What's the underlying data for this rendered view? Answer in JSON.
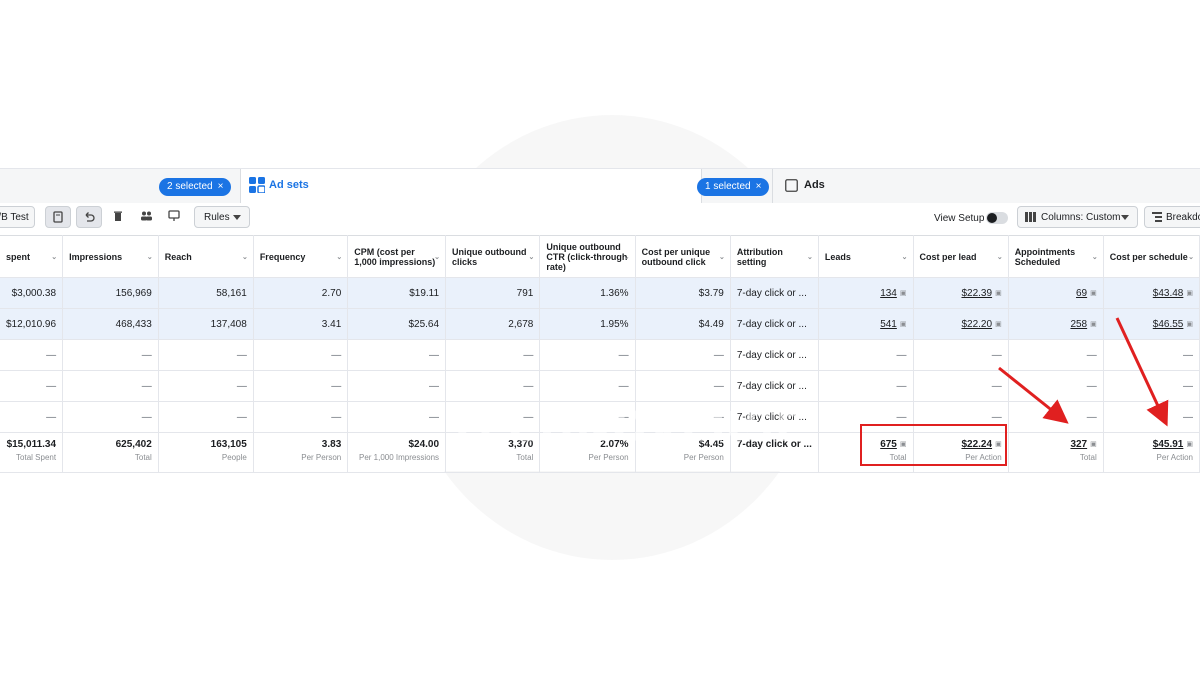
{
  "tabs": {
    "campaigns_selected": "2 selected",
    "adsets_label": "Ad sets",
    "adsets_selected": "1 selected",
    "ads_label": "Ads",
    "close_glyph": "×"
  },
  "toolbar": {
    "ab_test": "/B Test",
    "rules": "Rules",
    "view_setup": "View Setup",
    "columns": "Columns: Custom",
    "breakdown": "Breakdo"
  },
  "table": {
    "headers": [
      "spent",
      "Impressions",
      "Reach",
      "Frequency",
      "CPM (cost per 1,000 impressions)",
      "Unique outbound clicks",
      "Unique outbound CTR (click-through rate)",
      "Cost per unique outbound click",
      "Attribution setting",
      "Leads",
      "Cost per lead",
      "Appointments Scheduled",
      "Cost per schedule"
    ],
    "rows": [
      [
        "$3,000.38",
        "156,969",
        "58,161",
        "2.70",
        "$19.11",
        "791",
        "1.36%",
        "$3.79",
        "7-day click or ...",
        "134",
        "$22.39",
        "69",
        "$43.48"
      ],
      [
        "$12,010.96",
        "468,433",
        "137,408",
        "3.41",
        "$25.64",
        "2,678",
        "1.95%",
        "$4.49",
        "7-day click or ...",
        "541",
        "$22.20",
        "258",
        "$46.55"
      ],
      [
        "—",
        "—",
        "—",
        "—",
        "—",
        "—",
        "—",
        "—",
        "7-day click or ...",
        "—",
        "—",
        "—",
        "—"
      ],
      [
        "—",
        "—",
        "—",
        "—",
        "—",
        "—",
        "—",
        "—",
        "7-day click or ...",
        "—",
        "—",
        "—",
        "—"
      ],
      [
        "—",
        "—",
        "—",
        "—",
        "—",
        "—",
        "—",
        "—",
        "7-day click or ...",
        "—",
        "—",
        "—",
        "—"
      ]
    ],
    "totals": [
      {
        "value": "$15,011.34",
        "sub": "Total Spent"
      },
      {
        "value": "625,402",
        "sub": "Total"
      },
      {
        "value": "163,105",
        "sub": "People"
      },
      {
        "value": "3.83",
        "sub": "Per Person"
      },
      {
        "value": "$24.00",
        "sub": "Per 1,000 Impressions"
      },
      {
        "value": "3,370",
        "sub": "Total"
      },
      {
        "value": "2.07%",
        "sub": "Per Person"
      },
      {
        "value": "$4.45",
        "sub": "Per Person"
      },
      {
        "value": "7-day click or ...",
        "sub": ""
      },
      {
        "value": "675",
        "sub": "Total"
      },
      {
        "value": "$22.24",
        "sub": "Per Action"
      },
      {
        "value": "327",
        "sub": "Total"
      },
      {
        "value": "$45.91",
        "sub": "Per Action"
      }
    ]
  },
  "watermark": {
    "text": "TECHNOVERSE"
  },
  "colors": {
    "accent": "#1b74e4",
    "annotation": "#e02020",
    "selected_row": "#eaf1fb"
  }
}
